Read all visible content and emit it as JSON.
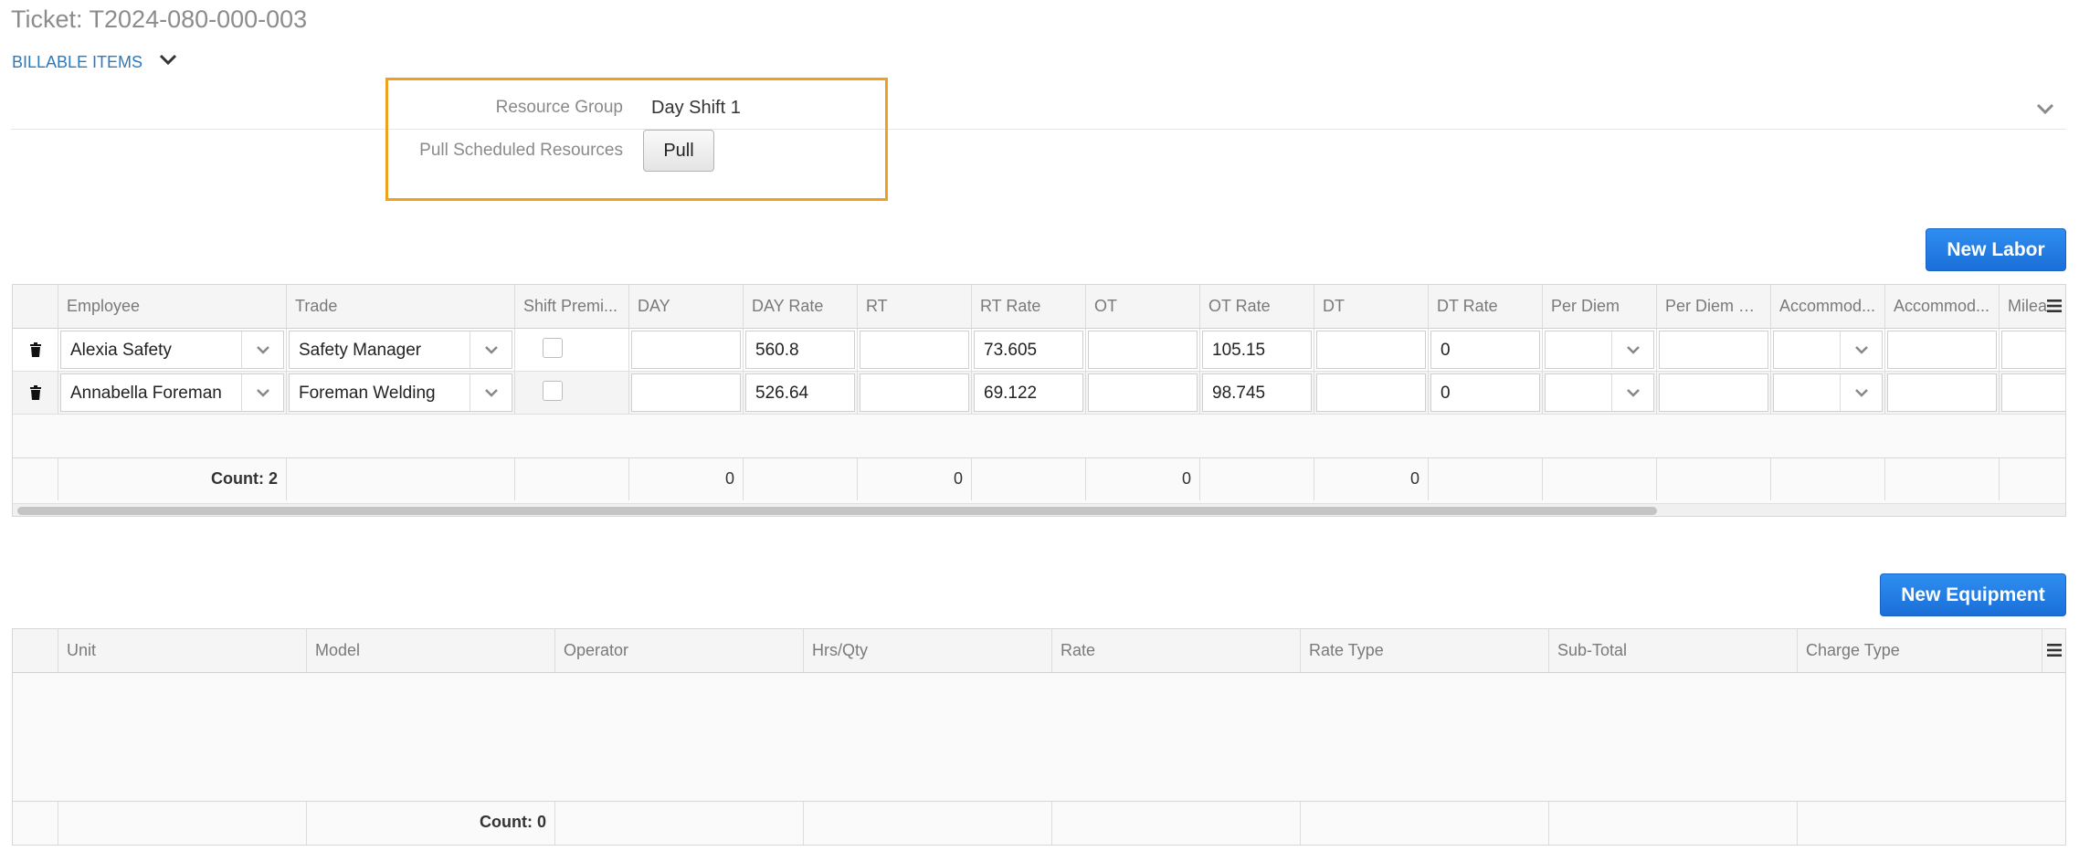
{
  "header": {
    "ticket_title": "Ticket: T2024-080-000-003",
    "billable_items_label": "BILLABLE ITEMS"
  },
  "resource": {
    "group_label": "Resource Group",
    "group_value": "Day Shift 1",
    "pull_label": "Pull Scheduled Resources",
    "pull_button": "Pull"
  },
  "buttons": {
    "new_labor": "New Labor",
    "new_equipment": "New Equipment"
  },
  "labor_grid": {
    "columns": [
      "Employee",
      "Trade",
      "Shift Premi...",
      "DAY",
      "DAY Rate",
      "RT",
      "RT Rate",
      "OT",
      "OT Rate",
      "DT",
      "DT Rate",
      "Per Diem",
      "Per Diem R...",
      "Accommod...",
      "Accommod...",
      "Milea"
    ],
    "rows": [
      {
        "employee": "Alexia Safety",
        "trade": "Safety Manager",
        "day": "",
        "day_rate": "560.8",
        "rt": "",
        "rt_rate": "73.605",
        "ot": "",
        "ot_rate": "105.15",
        "dt": "",
        "dt_rate": "0",
        "per_diem": "",
        "per_diem_rate": "",
        "accom": "",
        "accom_rate": "",
        "mileage": ""
      },
      {
        "employee": "Annabella Foreman",
        "trade": "Foreman Welding",
        "day": "",
        "day_rate": "526.64",
        "rt": "",
        "rt_rate": "69.122",
        "ot": "",
        "ot_rate": "98.745",
        "dt": "",
        "dt_rate": "0",
        "per_diem": "",
        "per_diem_rate": "",
        "accom": "",
        "accom_rate": "",
        "mileage": ""
      }
    ],
    "footer": {
      "count": "Count: 2",
      "day_total": "0",
      "rt_total": "0",
      "ot_total": "0",
      "dt_total": "0"
    }
  },
  "equipment_grid": {
    "columns": [
      "Unit",
      "Model",
      "Operator",
      "Hrs/Qty",
      "Rate",
      "Rate Type",
      "Sub-Total",
      "Charge Type"
    ],
    "footer": {
      "count": "Count: 0"
    }
  },
  "colors": {
    "primary_button": "#1a6fd8",
    "highlight_border": "#f0a020",
    "link": "#2a7ac0"
  },
  "icons": {
    "expand": "chevron-down-icon",
    "delete": "trash-icon",
    "grid_menu": "menu-icon"
  }
}
